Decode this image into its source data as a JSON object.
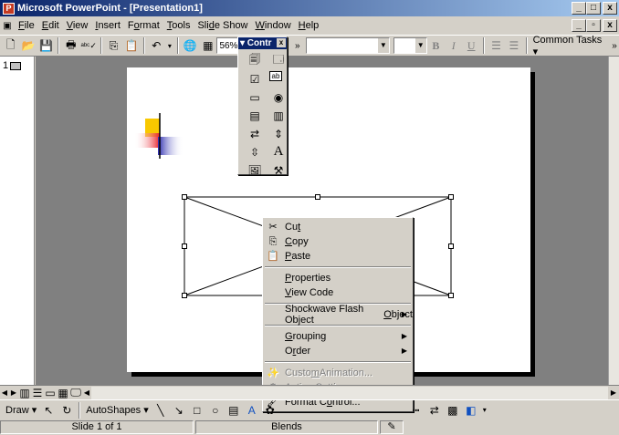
{
  "window": {
    "title": "Microsoft PowerPoint - [Presentation1]",
    "min": "_",
    "max": "□",
    "close": "x"
  },
  "menubar": {
    "items": [
      {
        "pre": "",
        "u": "F",
        "post": "ile"
      },
      {
        "pre": "",
        "u": "E",
        "post": "dit"
      },
      {
        "pre": "",
        "u": "V",
        "post": "iew"
      },
      {
        "pre": "",
        "u": "I",
        "post": "nsert"
      },
      {
        "pre": "F",
        "u": "o",
        "post": "rmat"
      },
      {
        "pre": "",
        "u": "T",
        "post": "ools"
      },
      {
        "pre": "Sli",
        "u": "d",
        "post": "e Show"
      },
      {
        "pre": "",
        "u": "W",
        "post": "indow"
      },
      {
        "pre": "",
        "u": "H",
        "post": "elp"
      }
    ],
    "doc_min": "_",
    "doc_restore": "▫",
    "doc_close": "x"
  },
  "toolbar": {
    "zoom": "56%",
    "font_box": "",
    "size_box": "",
    "common_tasks": "Common Tasks ▾"
  },
  "controls_toolbar": {
    "title": "▾ Contr",
    "close": "x"
  },
  "left_pane": {
    "slide_number": "1"
  },
  "context_menu": {
    "items": [
      {
        "pre": "Cu",
        "u": "t",
        "post": "",
        "icon": "scissors-icon",
        "glyph": "✂"
      },
      {
        "pre": "",
        "u": "C",
        "post": "opy",
        "icon": "copy-icon",
        "glyph": "⎘"
      },
      {
        "pre": "",
        "u": "P",
        "post": "aste",
        "icon": "paste-icon",
        "glyph": "📋"
      },
      {
        "pre": "",
        "u": "P",
        "post": "roperties"
      },
      {
        "pre": "",
        "u": "V",
        "post": "iew Code"
      },
      {
        "pre": "Shockwave Flash Object ",
        "u": "O",
        "post": "bject"
      },
      {
        "pre": "",
        "u": "G",
        "post": "rouping"
      },
      {
        "pre": "O",
        "u": "r",
        "post": "der"
      },
      {
        "pre": "Custo",
        "u": "m",
        "post": " Animation...",
        "icon": "animation-icon",
        "glyph": "✨"
      },
      {
        "pre": "Act",
        "u": "i",
        "post": "on Settings...",
        "icon": "action-settings-icon",
        "glyph": "⚙"
      },
      {
        "pre": "Format C",
        "u": "o",
        "post": "ntrol...",
        "icon": "format-control-icon",
        "glyph": "🖌"
      }
    ]
  },
  "drawbar": {
    "draw": "Draw ▾",
    "autoshapes": "AutoShapes ▾"
  },
  "statusbar": {
    "slide": "Slide 1 of 1",
    "design": "Blends"
  }
}
